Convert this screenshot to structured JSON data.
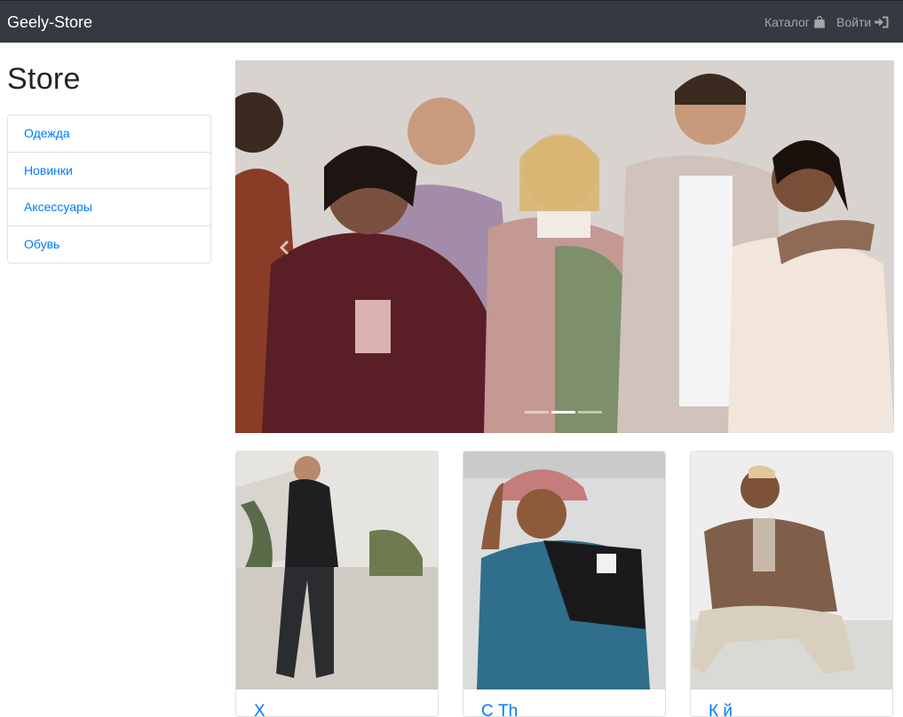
{
  "navbar": {
    "brand": "Geely-Store",
    "catalog_label": "Каталог",
    "catalog_icon": "shopping-bag-icon",
    "login_label": "Войти",
    "login_icon": "sign-in-icon",
    "bg_color": "#343a40"
  },
  "sidebar": {
    "title": "Store",
    "items": [
      {
        "label": "Одежда"
      },
      {
        "label": "Новинки"
      },
      {
        "label": "Аксессуары"
      },
      {
        "label": "Обувь"
      }
    ],
    "link_color": "#007bff"
  },
  "carousel": {
    "slide_count": 3,
    "active_index": 1,
    "prev_icon": "chevron-left-icon",
    "image": "group-fashion-photo"
  },
  "products": [
    {
      "title": "Х",
      "image": "man-black-tracksuit-photo"
    },
    {
      "title": "С                Th",
      "image": "man-blue-puffer-jacket-photo"
    },
    {
      "title": "К                    й",
      "image": "man-brown-fleece-photo"
    }
  ]
}
